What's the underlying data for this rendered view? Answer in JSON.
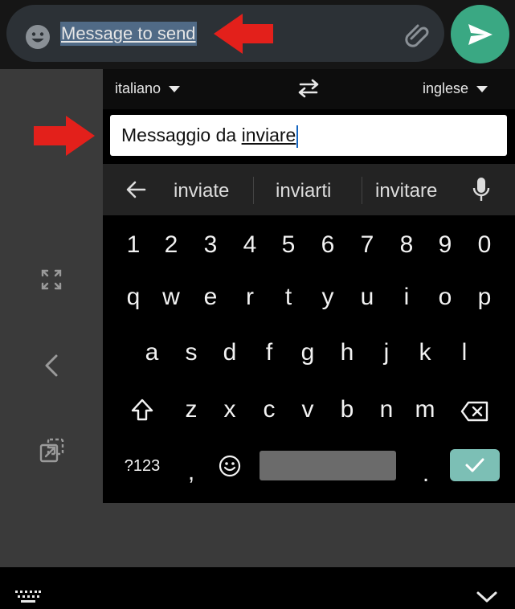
{
  "composer": {
    "message_text": "Message to send"
  },
  "translator": {
    "source_language": "italiano",
    "target_language": "inglese",
    "translated_prefix": "Messaggio da ",
    "translated_word": "inviare"
  },
  "suggestions": [
    "inviate",
    "inviarti",
    "invitare"
  ],
  "keyboard": {
    "number_row": [
      "1",
      "2",
      "3",
      "4",
      "5",
      "6",
      "7",
      "8",
      "9",
      "0"
    ],
    "row1": [
      "q",
      "w",
      "e",
      "r",
      "t",
      "y",
      "u",
      "i",
      "o",
      "p"
    ],
    "row2": [
      "a",
      "s",
      "d",
      "f",
      "g",
      "h",
      "j",
      "k",
      "l"
    ],
    "row3": [
      "z",
      "x",
      "c",
      "v",
      "b",
      "n",
      "m"
    ],
    "symbols_label": "?123",
    "comma": ",",
    "period": "."
  },
  "colors": {
    "send_button": "#3aa883",
    "enter_key": "#7cbfb5",
    "annotation_arrow": "#e3201b",
    "selection": "#506a86"
  }
}
